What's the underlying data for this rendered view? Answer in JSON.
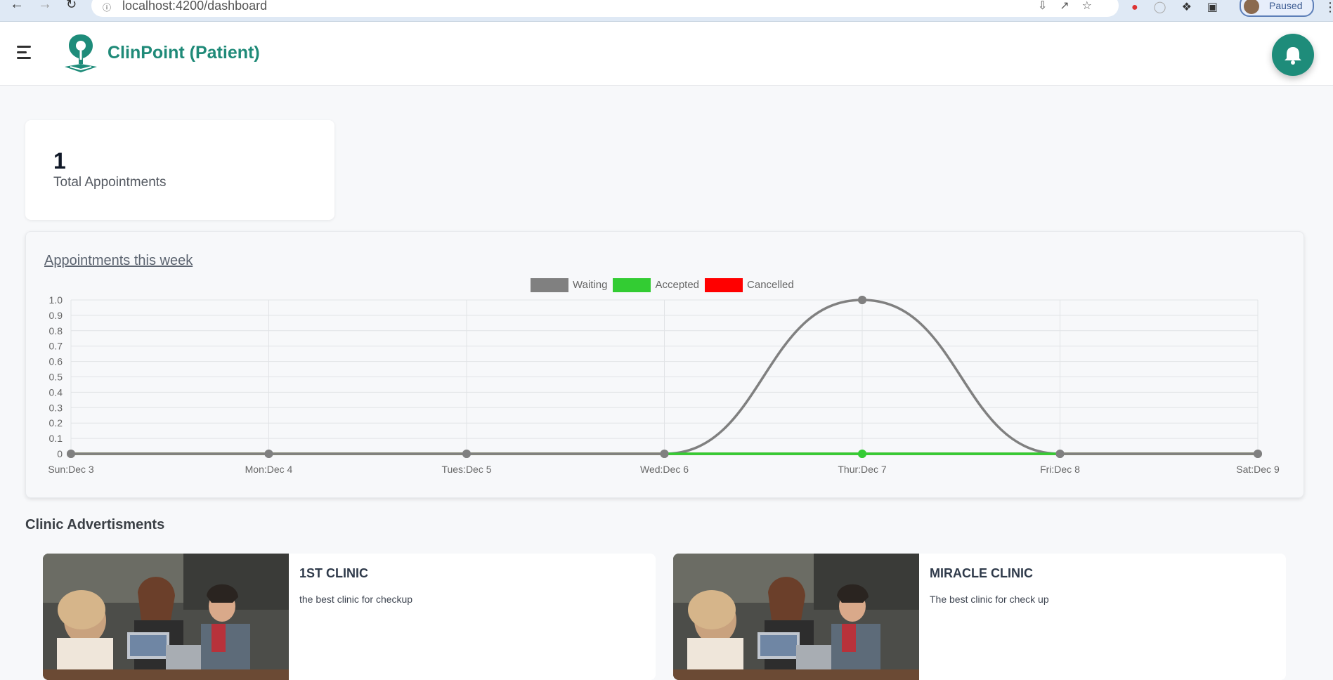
{
  "browser": {
    "url": "localhost:4200/dashboard",
    "profile_status": "Paused"
  },
  "header": {
    "brand": "ClinPoint (Patient)",
    "accent_color": "#1e8c7a"
  },
  "stats": {
    "total_appointments_value": "1",
    "total_appointments_label": "Total Appointments"
  },
  "chart_section": {
    "title": "Appointments this week"
  },
  "chart_data": {
    "type": "line",
    "categories": [
      "Sun:Dec 3",
      "Mon:Dec 4",
      "Tues:Dec 5",
      "Wed:Dec 6",
      "Thur:Dec 7",
      "Fri:Dec 8",
      "Sat:Dec 9"
    ],
    "series": [
      {
        "name": "Waiting",
        "color": "#808080",
        "values": [
          0,
          0,
          0,
          0,
          1,
          0,
          0
        ]
      },
      {
        "name": "Accepted",
        "color": "#33cc33",
        "values": [
          0,
          0,
          0,
          0,
          0,
          0,
          0
        ]
      },
      {
        "name": "Cancelled",
        "color": "#ff0000",
        "values": [
          0,
          0,
          0,
          0,
          0,
          0,
          0
        ]
      }
    ],
    "ylim": [
      0,
      1
    ],
    "yticks": [
      "1.0",
      "0.9",
      "0.8",
      "0.7",
      "0.6",
      "0.5",
      "0.4",
      "0.3",
      "0.2",
      "0.1",
      "0"
    ],
    "legend_position": "top-center",
    "grid": true
  },
  "ads": {
    "title": "Clinic Advertisments",
    "items": [
      {
        "name": "1ST CLINIC",
        "description": "the best clinic for checkup"
      },
      {
        "name": "MIRACLE CLINIC",
        "description": "The best clinic for check up"
      }
    ]
  }
}
